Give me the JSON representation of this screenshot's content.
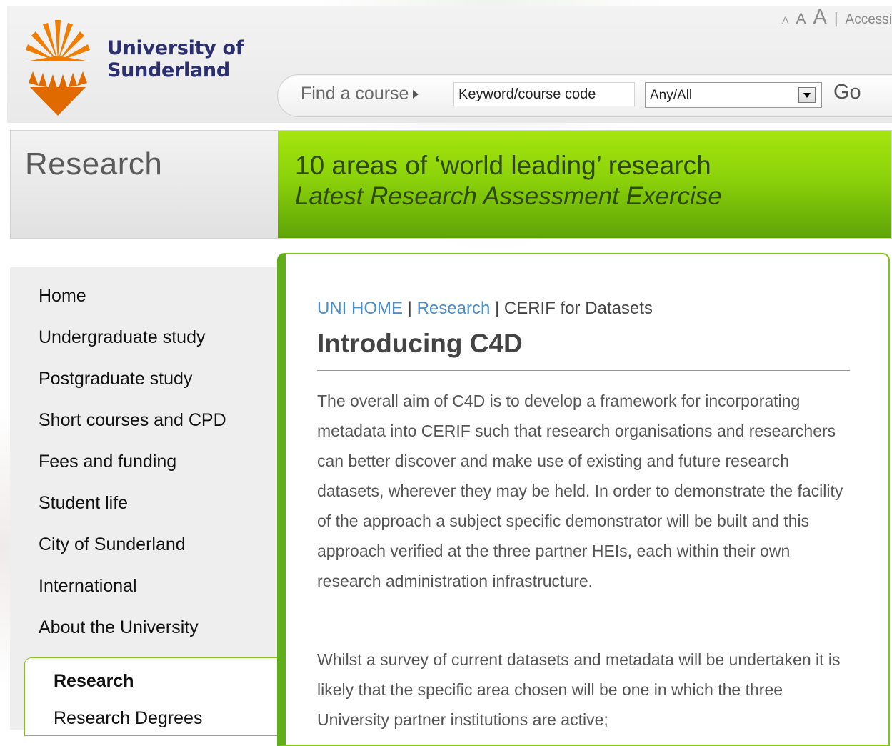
{
  "brand": {
    "name_line1": "University of",
    "name_line2": "Sunderland",
    "accent_orange": "#f07d00",
    "navy": "#2c2f6f",
    "green": "#7dc21f"
  },
  "accessibility": {
    "size_small": "A",
    "size_medium": "A",
    "size_large": "A",
    "separator": "|",
    "link": "Accessi"
  },
  "search": {
    "find_label": "Find a course",
    "keyword_value": "Keyword/course code",
    "select_value": "Any/All",
    "go_label": "Go"
  },
  "banner": {
    "section_title": "Research",
    "headline": "10 areas of ‘world leading’ research",
    "subline": "Latest Research Assessment Exercise"
  },
  "sidebar": {
    "items": [
      {
        "label": "Home"
      },
      {
        "label": "Undergraduate study"
      },
      {
        "label": "Postgraduate study"
      },
      {
        "label": "Short courses and CPD"
      },
      {
        "label": "Fees and funding"
      },
      {
        "label": "Student life"
      },
      {
        "label": "City of Sunderland"
      },
      {
        "label": "International"
      },
      {
        "label": "About the University"
      }
    ],
    "current": "Research",
    "subitem": "Research Degrees"
  },
  "breadcrumb": {
    "home": "UNI HOME",
    "sep1": " | ",
    "research": "Research",
    "sep2": " | ",
    "current": "CERIF for Datasets"
  },
  "main": {
    "title": "Introducing C4D",
    "paragraph1": "The overall aim of C4D is to develop a framework for incorporating metadata into CERIF such that research organisations and researchers can better discover and make use of existing and future research datasets, wherever they may be held. In order to demonstrate the facility of the approach a subject specific demonstrator will be built and this approach verified at the three partner HEIs, each within their own research administration infrastructure.",
    "paragraph2": "Whilst a survey of current datasets and metadata will be undertaken it is likely that the specific area chosen will be one in which the three University partner institutions are active;"
  }
}
